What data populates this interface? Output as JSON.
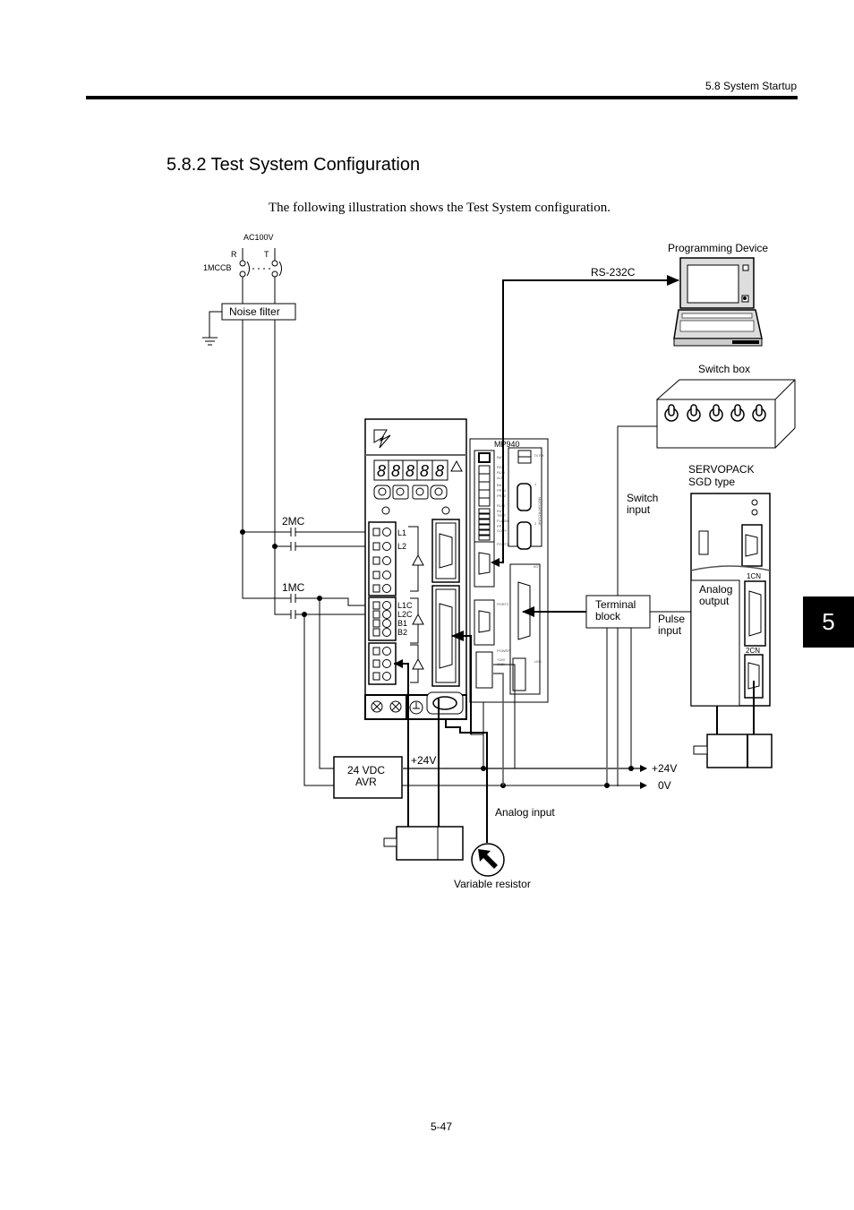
{
  "header": {
    "section": "5.8  System Startup"
  },
  "section_title": "5.8.2  Test System Configuration",
  "intro": "The following illustration shows the Test System configuration.",
  "chapter_tab": "5",
  "page_number": "5-47",
  "diagram": {
    "power": {
      "source": "AC100V",
      "phase_r": "R",
      "phase_t": "T",
      "breaker": "1MCCB",
      "noise_filter": "Noise filter"
    },
    "contactors": {
      "mc2": "2MC",
      "mc1": "1MC"
    },
    "servopack_terminals": [
      "L1",
      "L2",
      "L1C",
      "L2C",
      "B1",
      "B2"
    ],
    "controller": {
      "name": "MP940",
      "leds_left": [
        "BAT",
        "RDY",
        "RUN",
        "ALM",
        "BAT",
        "PRT1",
        "PRT2"
      ],
      "dip_labels": [
        "RUN",
        "INIT",
        "TEST",
        "FLASH",
        "PP",
        "COPY"
      ],
      "port1": "PORT1",
      "port2": "PORT2",
      "io": "I/O",
      "power": "POWER",
      "power_pins": [
        "+24V",
        "GND",
        "FG"
      ],
      "led": "LED",
      "txrx": "TX RX",
      "mechatrolink": "MECHATROLINK",
      "mechatrolink_ports": [
        "1",
        "2"
      ]
    },
    "rs232c": "RS-232C",
    "programming_device": "Programming Device",
    "switch_box": "Switch box",
    "switch_input": "Switch input",
    "terminal_block": [
      "Terminal",
      "block"
    ],
    "pulse_input": [
      "Pulse",
      "input"
    ],
    "servopack_sgd": {
      "title": [
        "SERVOPACK",
        "SGD type"
      ],
      "cn1": "1CN",
      "cn2": "2CN",
      "analog_output": [
        "Analog",
        "output"
      ]
    },
    "avr": [
      "24 VDC",
      "AVR"
    ],
    "plus24v_label": "+24V",
    "rail_plus24v": "+24V",
    "rail_0v": "0V",
    "analog_input": "Analog input",
    "variable_resistor": "Variable resistor"
  }
}
